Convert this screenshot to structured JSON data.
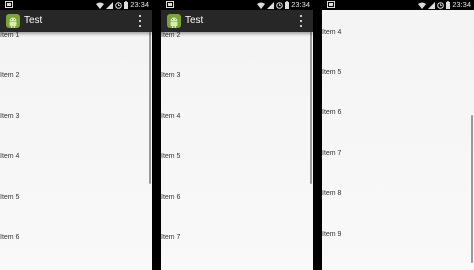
{
  "status_bar": {
    "time": "23:34"
  },
  "app": {
    "title": "Test"
  },
  "screens": [
    {
      "items": [
        "Item 1",
        "Item 2",
        "Item 3",
        "Item 4",
        "Item 5",
        "Item 6"
      ]
    },
    {
      "items": [
        "Item 2",
        "Item 3",
        "Item 4",
        "Item 5",
        "Item 6",
        "Item 7"
      ]
    },
    {
      "items": [
        "Item 4",
        "Item 5",
        "Item 6",
        "Item 7",
        "Item 8",
        "Item 9"
      ]
    }
  ],
  "colors": {
    "status_bar": "#000000",
    "action_bar": "#272727",
    "list_background": "#f4f4f4",
    "item_text": "#333333",
    "scrollbar": "#9a9a9a"
  },
  "icons": [
    "android-notification-icon",
    "wifi-icon",
    "signal-icon",
    "alarm-icon",
    "battery-icon",
    "android-app-icon",
    "overflow-menu-icon"
  ]
}
